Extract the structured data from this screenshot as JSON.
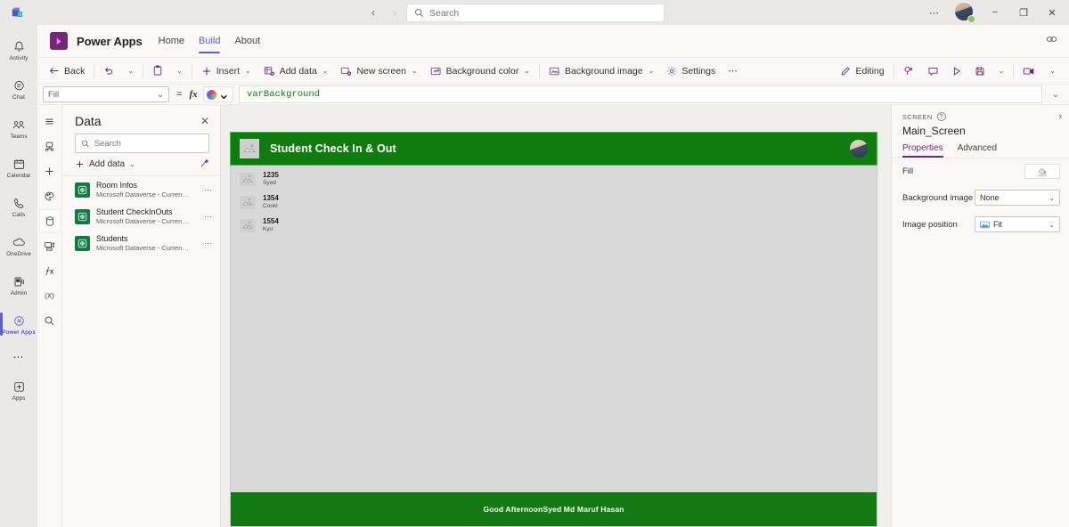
{
  "titlebar": {
    "app_icon": "microsoft-teams-logo",
    "back_arrow": "‹",
    "forward_arrow": "›",
    "search_placeholder": "Search",
    "search_value": "",
    "more_label": "⋯",
    "minimize_label": "−",
    "maximize_label": "❐",
    "close_label": "✕",
    "presence_color": "#92c353"
  },
  "rail": {
    "items": [
      {
        "label": "Activity",
        "icon": "bell-icon",
        "active": false
      },
      {
        "label": "Chat",
        "icon": "chat-icon",
        "active": false
      },
      {
        "label": "Teams",
        "icon": "teams-icon",
        "active": false
      },
      {
        "label": "Calendar",
        "icon": "calendar-icon",
        "active": false
      },
      {
        "label": "Calls",
        "icon": "phone-icon",
        "active": false
      },
      {
        "label": "OneDrive",
        "icon": "cloud-icon",
        "active": false
      },
      {
        "label": "Admin",
        "icon": "admin-icon",
        "active": false
      },
      {
        "label": "Power Apps",
        "icon": "power-apps-icon",
        "active": true
      }
    ],
    "overflow_label": "⋯",
    "apps": {
      "label": "Apps",
      "icon": "plus-box-icon"
    }
  },
  "pa_header": {
    "logo_icon": "power-apps-logo",
    "title": "Power Apps",
    "navs": [
      {
        "label": "Home",
        "active": false
      },
      {
        "label": "Build",
        "active": true
      },
      {
        "label": "About",
        "active": false
      }
    ],
    "right_icon": "link-chain-icon"
  },
  "toolbar": {
    "back": {
      "label": "Back",
      "icon": "arrow-left-icon"
    },
    "undo": {
      "icon": "undo-icon"
    },
    "undo_chevron": "⌄",
    "paste": {
      "icon": "paste-icon"
    },
    "paste_chevron": "⌄",
    "insert": {
      "label": "Insert",
      "icon": "plus-icon",
      "chevron": "⌄"
    },
    "add_data": {
      "label": "Add data",
      "icon": "database-add-icon",
      "chevron": "⌄"
    },
    "new_screen": {
      "label": "New screen",
      "icon": "new-screen-icon",
      "chevron": "⌄"
    },
    "background_color": {
      "label": "Background color",
      "icon": "background-color-icon",
      "chevron": "⌄"
    },
    "background_image": {
      "label": "Background image",
      "icon": "image-icon",
      "chevron": "⌄"
    },
    "settings": {
      "label": "Settings",
      "icon": "gear-icon"
    },
    "overflow": "⋯",
    "right": {
      "editing": {
        "label": "Editing",
        "icon": "pencil-icon"
      },
      "app_checker": {
        "icon": "app-checker-icon"
      },
      "comments": {
        "icon": "comment-icon"
      },
      "preview": {
        "icon": "play-icon"
      },
      "save": {
        "icon": "save-icon"
      },
      "save_chevron": "⌄",
      "share": {
        "icon": "share-video-icon"
      },
      "share_chevron": "⌄"
    }
  },
  "formula_bar": {
    "property": "Fill",
    "property_chevron": "⌄",
    "equals": "=",
    "fx": "fx",
    "copilot_icon": "copilot-icon",
    "copilot_chevron": "⌄",
    "formula": "varBackground",
    "expand_chevron": "⌄",
    "formula_color": "#107c10"
  },
  "auth_rail": {
    "items": [
      {
        "icon": "hamburger-menu-icon",
        "name": "menu",
        "active": false
      },
      {
        "icon": "tree-view-icon",
        "name": "tree-view",
        "active": false
      },
      {
        "icon": "insert-plus-icon",
        "name": "insert",
        "active": false
      },
      {
        "icon": "theme-palette-icon",
        "name": "theme",
        "active": false
      },
      {
        "icon": "data-cylinder-icon",
        "name": "data",
        "active": true
      },
      {
        "icon": "media-icon",
        "name": "media",
        "active": false
      },
      {
        "icon": "power-fx-icon",
        "name": "power-fx",
        "active": false
      },
      {
        "icon": "variables-icon",
        "name": "variables",
        "label": "(X)",
        "active": false
      },
      {
        "icon": "search-icon",
        "name": "search",
        "active": false
      }
    ]
  },
  "data_panel": {
    "title": "Data",
    "close_label": "✕",
    "search_placeholder": "Search",
    "search_value": "",
    "add_data_label": "Add data",
    "add_data_chevron": "⌄",
    "magic_icon": "magic-wand-icon",
    "sources": [
      {
        "name": "Room Infos",
        "subtitle": "Microsoft Dataverse - Current environm...",
        "icon": "dataverse-icon",
        "more": "⋯"
      },
      {
        "name": "Student CheckInOuts",
        "subtitle": "Microsoft Dataverse - Current environm...",
        "icon": "dataverse-icon",
        "more": "⋯"
      },
      {
        "name": "Students",
        "subtitle": "Microsoft Dataverse - Current environm...",
        "icon": "dataverse-icon",
        "more": "⋯"
      }
    ]
  },
  "canvas": {
    "header": {
      "image_placeholder_icon": "image-placeholder-icon",
      "title": "Student Check In & Out",
      "avatar_icon": "user-avatar",
      "background_color": "#107c10"
    },
    "gallery": [
      {
        "title": "1235",
        "subtitle": "Syed",
        "icon": "image-placeholder-icon"
      },
      {
        "title": "1354",
        "subtitle": "Cookl",
        "icon": "image-placeholder-icon"
      },
      {
        "title": "1554",
        "subtitle": "Kyu",
        "icon": "image-placeholder-icon"
      }
    ],
    "footer": {
      "text": "Good AfternoonSyed Md Maruf Hasan",
      "background_color": "#137a13"
    },
    "background_color": "#d9d9d9"
  },
  "properties_panel": {
    "section_label": "SCREEN",
    "help_icon": "help-icon",
    "expand_icon": "chevron-right-icon",
    "screen_name": "Main_Screen",
    "tabs": [
      {
        "label": "Properties",
        "active": true
      },
      {
        "label": "Advanced",
        "active": false
      }
    ],
    "rows": [
      {
        "label": "Fill",
        "type": "color",
        "value": "",
        "icon": "color-fill-icon"
      },
      {
        "label": "Background image",
        "type": "select",
        "value": "None",
        "chevron": "⌄"
      },
      {
        "label": "Image position",
        "type": "select",
        "value": "Fit",
        "icon": "image-icon",
        "chevron": "⌄"
      }
    ]
  }
}
